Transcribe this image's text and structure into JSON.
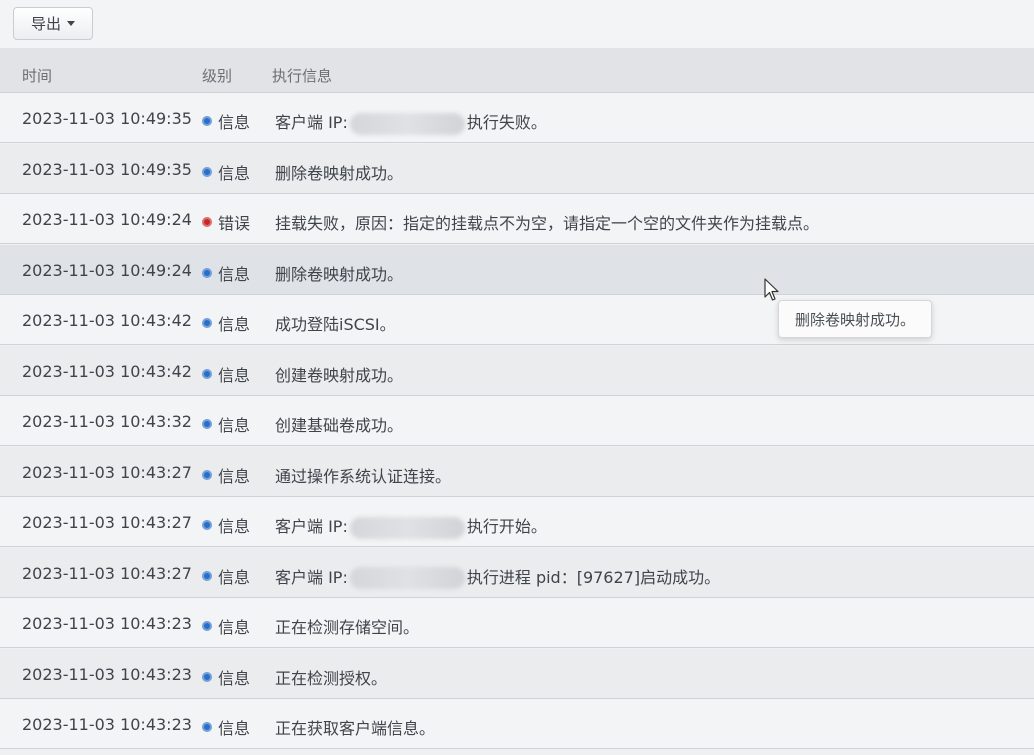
{
  "toolbar": {
    "export_label": "导出"
  },
  "table": {
    "columns": {
      "time": "时间",
      "level": "级别",
      "message": "执行信息"
    },
    "rows": [
      {
        "time": "2023-11-03 10:49:35",
        "level": "信息",
        "level_type": "info",
        "msg_pre": "客户端 IP:",
        "redacted": true,
        "msg_post": "执行失败。"
      },
      {
        "time": "2023-11-03 10:49:35",
        "level": "信息",
        "level_type": "info",
        "msg_pre": "删除卷映射成功。",
        "redacted": false,
        "msg_post": ""
      },
      {
        "time": "2023-11-03 10:49:24",
        "level": "错误",
        "level_type": "error",
        "msg_pre": "挂载失败，原因：指定的挂载点不为空，请指定一个空的文件夹作为挂载点。",
        "redacted": false,
        "msg_post": ""
      },
      {
        "time": "2023-11-03 10:49:24",
        "level": "信息",
        "level_type": "info",
        "msg_pre": "删除卷映射成功。",
        "redacted": false,
        "msg_post": ""
      },
      {
        "time": "2023-11-03 10:43:42",
        "level": "信息",
        "level_type": "info",
        "msg_pre": "成功登陆iSCSI。",
        "redacted": false,
        "msg_post": ""
      },
      {
        "time": "2023-11-03 10:43:42",
        "level": "信息",
        "level_type": "info",
        "msg_pre": "创建卷映射成功。",
        "redacted": false,
        "msg_post": ""
      },
      {
        "time": "2023-11-03 10:43:32",
        "level": "信息",
        "level_type": "info",
        "msg_pre": "创建基础卷成功。",
        "redacted": false,
        "msg_post": ""
      },
      {
        "time": "2023-11-03 10:43:27",
        "level": "信息",
        "level_type": "info",
        "msg_pre": "通过操作系统认证连接。",
        "redacted": false,
        "msg_post": ""
      },
      {
        "time": "2023-11-03 10:43:27",
        "level": "信息",
        "level_type": "info",
        "msg_pre": "客户端 IP:",
        "redacted": true,
        "msg_post": "执行开始。"
      },
      {
        "time": "2023-11-03 10:43:27",
        "level": "信息",
        "level_type": "info",
        "msg_pre": "客户端 IP:",
        "redacted": true,
        "msg_post": "执行进程 pid：[97627]启动成功。"
      },
      {
        "time": "2023-11-03 10:43:23",
        "level": "信息",
        "level_type": "info",
        "msg_pre": "正在检测存储空间。",
        "redacted": false,
        "msg_post": ""
      },
      {
        "time": "2023-11-03 10:43:23",
        "level": "信息",
        "level_type": "info",
        "msg_pre": "正在检测授权。",
        "redacted": false,
        "msg_post": ""
      },
      {
        "time": "2023-11-03 10:43:23",
        "level": "信息",
        "level_type": "info",
        "msg_pre": "正在获取客户端信息。",
        "redacted": false,
        "msg_post": ""
      }
    ]
  },
  "tooltip": {
    "text": "删除卷映射成功。"
  },
  "icons": {
    "cursor": "mouse-pointer-icon",
    "caret": "caret-down-icon",
    "info": "info-dot-icon",
    "error": "error-dot-icon"
  },
  "colors": {
    "info": "#2a6fc7",
    "error": "#c62828"
  }
}
